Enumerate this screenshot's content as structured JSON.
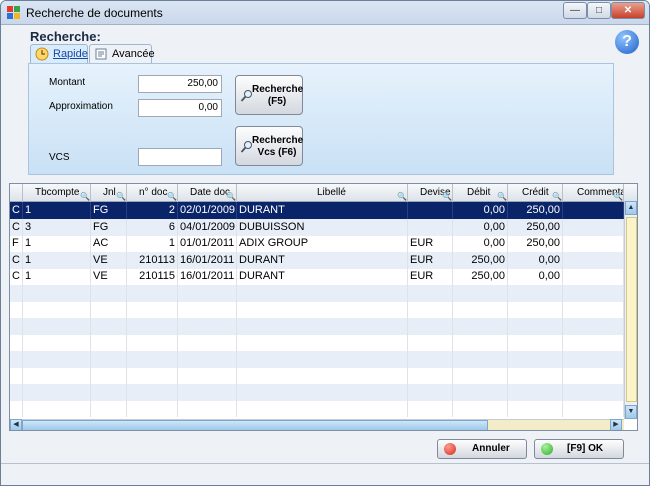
{
  "window": {
    "title": "Recherche de documents",
    "minimize_symbol": "—",
    "maximize_symbol": "□",
    "close_symbol": "✕"
  },
  "search": {
    "heading": "Recherche:",
    "help_symbol": "?",
    "tabs": [
      {
        "label": "Rapide",
        "active": true,
        "icon": "clock-icon"
      },
      {
        "label": "Avancée",
        "active": false,
        "icon": "document-icon"
      }
    ],
    "montant_label": "Montant",
    "montant_value": "250,00",
    "approximation_label": "Approximation",
    "approximation_value": "0,00",
    "vcs_label": "VCS",
    "vcs_value": "",
    "recherche_button_line1": "Recherche",
    "recherche_button_line2": "(F5)",
    "recherche_vcs_button_line1": "Recherche",
    "recherche_vcs_button_line2": "Vcs (F6)"
  },
  "grid": {
    "columns": [
      "",
      "Tbcompte",
      "Jnl",
      "n° doc",
      "Date doc",
      "Libellé",
      "Devise",
      "Débit",
      "Crédit",
      "Commentai"
    ],
    "rows": [
      [
        "C",
        "1",
        "FG",
        "2",
        "02/01/2009",
        "DURANT",
        "",
        "0,00",
        "250,00",
        ""
      ],
      [
        "C",
        "3",
        "FG",
        "6",
        "04/01/2009",
        "DUBUISSON",
        "",
        "0,00",
        "250,00",
        ""
      ],
      [
        "F",
        "1",
        "AC",
        "1",
        "01/01/2011",
        "ADIX GROUP",
        "EUR",
        "0,00",
        "250,00",
        ""
      ],
      [
        "C",
        "1",
        "VE",
        "210113",
        "16/01/2011",
        "DURANT",
        "EUR",
        "250,00",
        "0,00",
        ""
      ],
      [
        "C",
        "1",
        "VE",
        "210115",
        "16/01/2011",
        "DURANT",
        "EUR",
        "250,00",
        "0,00",
        ""
      ]
    ],
    "selected_row": 0
  },
  "footer": {
    "cancel_label": "Annuler",
    "ok_label": "[F9]  OK"
  },
  "colors": {
    "selection": "#0a246a",
    "cancel_dot": "#d62a1e",
    "ok_dot": "#2fae2a"
  }
}
